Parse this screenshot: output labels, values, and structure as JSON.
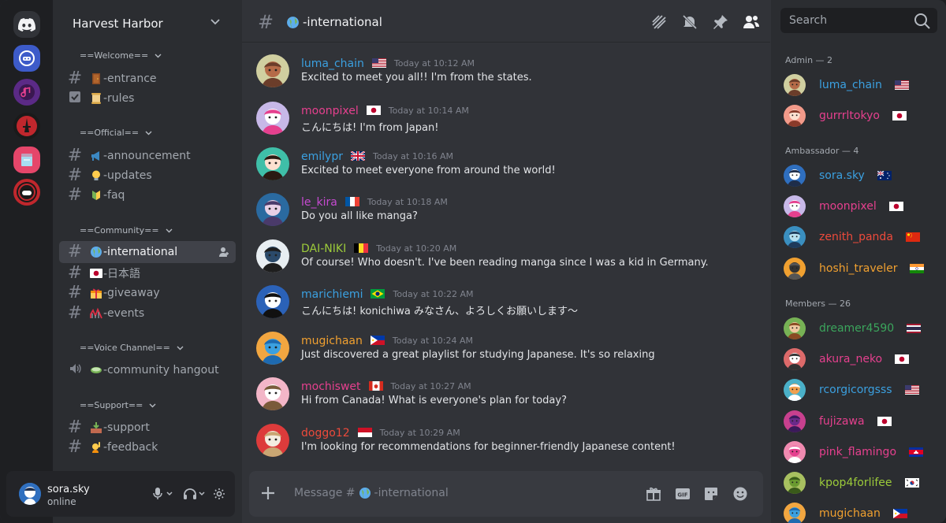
{
  "server": {
    "name": "Harvest Harbor",
    "categories": [
      {
        "label": "==Welcome==",
        "channels": [
          {
            "label": "-entrance",
            "emoji": "door"
          },
          {
            "label": "-rules",
            "emoji": "scroll"
          }
        ]
      },
      {
        "label": "==Official==",
        "channels": [
          {
            "label": "-announcement",
            "emoji": "megaphone"
          },
          {
            "label": "-updates",
            "emoji": "light-bulb"
          },
          {
            "label": "-faq",
            "emoji": "beginner-symbol"
          }
        ]
      },
      {
        "label": "==Community==",
        "channels": [
          {
            "label": "-international",
            "emoji": "globe"
          },
          {
            "label": "-日本語",
            "emoji": "japan-flag"
          },
          {
            "label": "-giveaway",
            "emoji": "gift"
          },
          {
            "label": "-events",
            "emoji": "roller-coaster"
          }
        ]
      },
      {
        "label": "==Voice Channel==",
        "channels": [
          {
            "label": "-community hangout",
            "emoji": "tea"
          }
        ]
      },
      {
        "label": "==Support==",
        "channels": [
          {
            "label": "-support",
            "emoji": "inbox-tray"
          },
          {
            "label": "-feedback",
            "emoji": "raising-hand"
          }
        ]
      }
    ]
  },
  "user": {
    "name": "sora.sky",
    "status": "online"
  },
  "channel": {
    "name": "-international"
  },
  "messages": [
    {
      "author": "luma_chain",
      "color": "#3ba0e0",
      "flag": "us",
      "time": "Today at 10:12 AM",
      "text": "Excited to meet you all!! I'm from the states."
    },
    {
      "author": "moonpixel",
      "color": "#e5408e",
      "flag": "jp",
      "time": "Today at 10:14 AM",
      "text": "こんにちは! I'm from Japan!"
    },
    {
      "author": "emilypr",
      "color": "#3ba0e0",
      "flag": "gb",
      "time": "Today at 10:16 AM",
      "text": "Excited to meet everyone from around the world!"
    },
    {
      "author": "le_kira",
      "color": "#c64ad1",
      "flag": "fr",
      "time": "Today at 10:18 AM",
      "text": "Do you all like manga?"
    },
    {
      "author": "DAI-NIKI",
      "color": "#9ccb3a",
      "flag": "be",
      "time": "Today at 10:20 AM",
      "text": "Of course! Who doesn't. I've been reading manga since I was a kid in Germany."
    },
    {
      "author": "marichiemi",
      "color": "#3ba0e0",
      "flag": "br",
      "time": "Today at 10:22 AM",
      "text": "こんにちは! konichiwa みなさん、よろしくお願いします〜"
    },
    {
      "author": "mugichaan",
      "color": "#f0a030",
      "flag": "ph",
      "time": "Today at 10:24 AM",
      "text": "Just discovered a great playlist for studying Japanese. It's so relaxing"
    },
    {
      "author": "mochiswet",
      "color": "#e5408e",
      "flag": "ca",
      "time": "Today at 10:27 AM",
      "text": "Hi from Canada! What is everyone's plan for today?"
    },
    {
      "author": "doggo12",
      "color": "#ed4a3b",
      "flag": "id",
      "time": "Today at 10:29 AM",
      "text": "I'm looking for recommendations for beginner-friendly Japanese content!"
    }
  ],
  "composer": {
    "placeholder_prefix": "Message #",
    "channel": "-international"
  },
  "search": {
    "placeholder": "Search"
  },
  "member_groups": [
    {
      "label": "Admin — 2",
      "members": [
        {
          "name": "luma_chain",
          "color": "#3ba0e0",
          "flag": "us"
        },
        {
          "name": "gurrrltokyo",
          "color": "#e5408e",
          "flag": "jp"
        }
      ]
    },
    {
      "label": "Ambassador — 4",
      "members": [
        {
          "name": "sora.sky",
          "color": "#3ba0e0",
          "flag": "au"
        },
        {
          "name": "moonpixel",
          "color": "#e5408e",
          "flag": "jp"
        },
        {
          "name": "zenith_panda",
          "color": "#ed4a3b",
          "flag": "cn"
        },
        {
          "name": "hoshi_traveler",
          "color": "#f0a030",
          "flag": "in"
        }
      ]
    },
    {
      "label": "Members — 26",
      "members": [
        {
          "name": "dreamer4590",
          "color": "#3ba55c",
          "flag": "th"
        },
        {
          "name": "akura_neko",
          "color": "#e5408e",
          "flag": "jp"
        },
        {
          "name": "rcorgicorgsss",
          "color": "#3ba0e0",
          "flag": "us"
        },
        {
          "name": "fujizawa",
          "color": "#e5408e",
          "flag": "jp"
        },
        {
          "name": "pink_flamingo",
          "color": "#e5408e",
          "flag": "kh"
        },
        {
          "name": "kpop4forlifee",
          "color": "#9ccb3a",
          "flag": "kr"
        },
        {
          "name": "mugichaan",
          "color": "#f0a030",
          "flag": "ph"
        }
      ]
    }
  ]
}
